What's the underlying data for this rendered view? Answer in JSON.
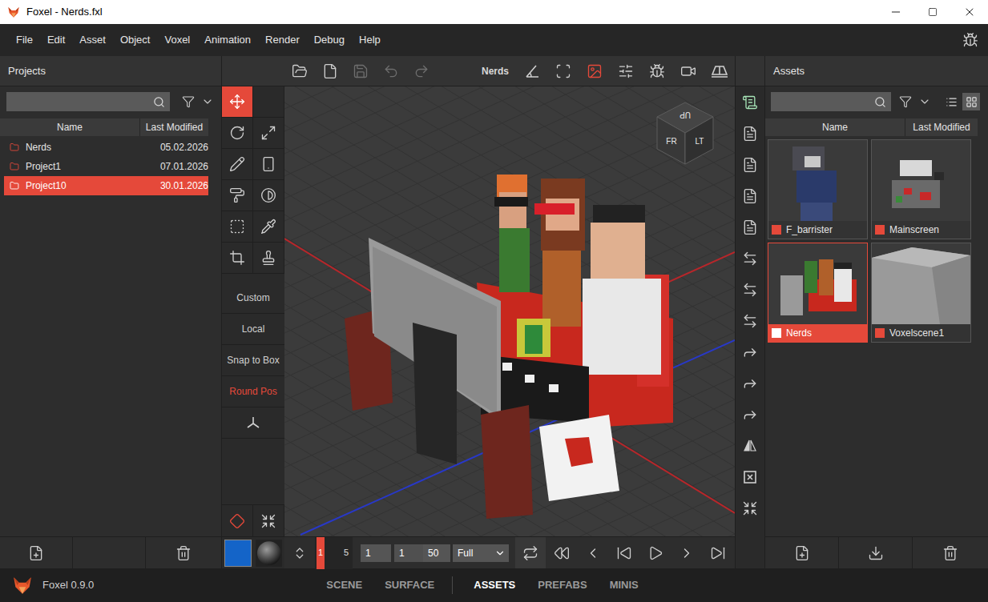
{
  "window": {
    "title": "Foxel - Nerds.fxl"
  },
  "menu": [
    "File",
    "Edit",
    "Asset",
    "Object",
    "Voxel",
    "Animation",
    "Render",
    "Debug",
    "Help"
  ],
  "projects": {
    "title": "Projects",
    "search": {
      "value": ""
    },
    "columns": [
      "Name",
      "Last Modified"
    ],
    "rows": [
      {
        "name": "Nerds",
        "modified": "05.02.2026",
        "selected": false
      },
      {
        "name": "Project1",
        "modified": "07.01.2026",
        "selected": false
      },
      {
        "name": "Project10",
        "modified": "30.01.2026",
        "selected": true
      }
    ]
  },
  "tools": [
    {
      "selected": true
    },
    {
      "selected": false
    },
    {
      "selected": false
    },
    {
      "selected": false
    },
    {
      "selected": false
    },
    {
      "selected": false
    },
    {
      "selected": false
    },
    {
      "selected": false
    },
    {
      "selected": false
    },
    {
      "selected": false
    },
    {
      "selected": false
    }
  ],
  "tool_options": [
    {
      "label": "Custom",
      "active": false
    },
    {
      "label": "Local",
      "active": false
    },
    {
      "label": "Snap to Box",
      "active": false
    },
    {
      "label": "Round Pos",
      "active": true
    }
  ],
  "pivot_tools": [
    {
      "selected": true
    },
    {
      "selected": false
    }
  ],
  "viewport": {
    "toolbar": {
      "title": "Nerds",
      "file_buttons": [
        {
          "disabled": false
        },
        {
          "disabled": false
        },
        {
          "disabled": true
        },
        {
          "disabled": true
        },
        {
          "disabled": true
        }
      ],
      "view_buttons": [
        {
          "selected": false
        },
        {
          "selected": false
        },
        {
          "selected": true
        },
        {
          "selected": false
        },
        {
          "selected": false
        },
        {
          "selected": false
        },
        {
          "selected": false
        }
      ]
    },
    "cube": {
      "top": "UP",
      "front": "FR",
      "left": "LT"
    }
  },
  "side_tools": [
    {
      "selected": true
    },
    {
      "selected": false
    },
    {
      "selected": false
    },
    {
      "selected": false
    },
    {
      "selected": false
    },
    {
      "selected": false
    },
    {
      "selected": false
    },
    {
      "selected": false
    },
    {
      "selected": false
    },
    {
      "selected": false
    },
    {
      "selected": false
    },
    {
      "selected": false
    },
    {
      "selected": false
    },
    {
      "selected": false
    }
  ],
  "assets": {
    "title": "Assets",
    "search": {
      "value": ""
    },
    "views": [
      {
        "selected": false
      },
      {
        "selected": true
      }
    ],
    "columns": [
      "Name",
      "Last Modified"
    ],
    "items": [
      {
        "name": "F_barrister",
        "selected": false
      },
      {
        "name": "Mainscreen",
        "selected": false
      },
      {
        "name": "Nerds",
        "selected": true
      },
      {
        "name": "Voxelscene1",
        "selected": false
      }
    ]
  },
  "timeline": {
    "frame": "1",
    "marker": "5",
    "fields": [
      "1",
      "1",
      "50"
    ],
    "range": "Full"
  },
  "status": {
    "app": "Foxel 0.9.0",
    "tabs": [
      {
        "label": "SCENE",
        "selected": false
      },
      {
        "label": "SURFACE",
        "selected": false
      },
      {
        "label": "ASSETS",
        "selected": true
      },
      {
        "label": "PREFABS",
        "selected": false
      },
      {
        "label": "MINIS",
        "selected": false
      }
    ]
  }
}
